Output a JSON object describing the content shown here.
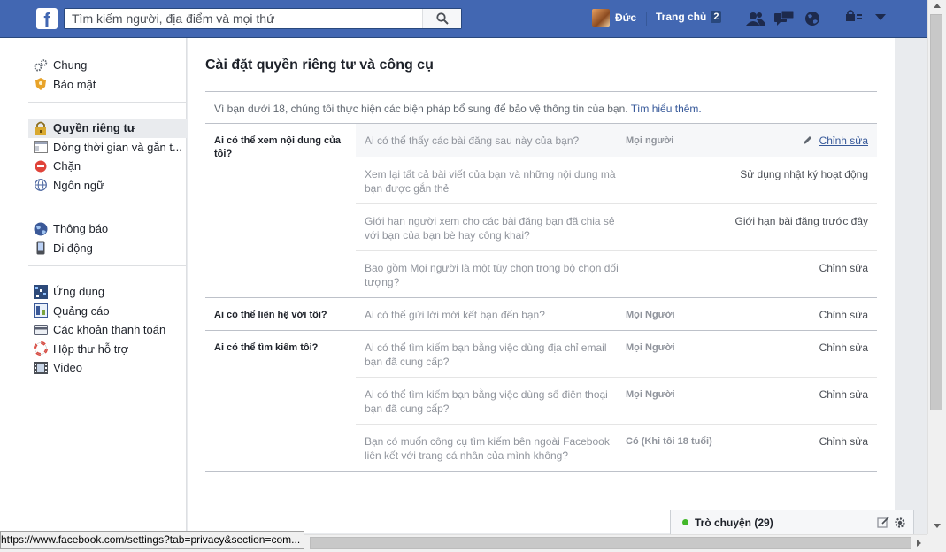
{
  "topbar": {
    "logo": "f",
    "search_placeholder": "Tìm kiếm người, địa điểm và mọi thứ",
    "user_name": "Đức",
    "home_label": "Trang chủ",
    "home_count": "2"
  },
  "sidebar": {
    "groups": [
      {
        "items": [
          {
            "label": "Chung",
            "icon": "gear-icon"
          },
          {
            "label": "Bảo mật",
            "icon": "security-badge-icon"
          }
        ]
      },
      {
        "items": [
          {
            "label": "Quyền riêng tư",
            "icon": "lock-icon",
            "active": true
          },
          {
            "label": "Dòng thời gian và gắn t...",
            "icon": "timeline-icon"
          },
          {
            "label": "Chặn",
            "icon": "block-icon"
          },
          {
            "label": "Ngôn ngữ",
            "icon": "globe-icon"
          }
        ]
      },
      {
        "items": [
          {
            "label": "Thông báo",
            "icon": "notification-globe-icon"
          },
          {
            "label": "Di động",
            "icon": "mobile-icon"
          }
        ]
      },
      {
        "items": [
          {
            "label": "Ứng dụng",
            "icon": "apps-icon"
          },
          {
            "label": "Quảng cáo",
            "icon": "ads-icon"
          },
          {
            "label": "Các khoản thanh toán",
            "icon": "credit-card-icon"
          },
          {
            "label": "Hộp thư hỗ trợ",
            "icon": "lifebuoy-icon"
          },
          {
            "label": "Video",
            "icon": "film-icon"
          }
        ]
      }
    ]
  },
  "main": {
    "title": "Cài đặt quyền riêng tư và công cụ",
    "notice_text": "Vì bạn dưới 18, chúng tôi thực hiện các biện pháp bổ sung để bảo vệ thông tin của bạn. ",
    "notice_link": "Tìm hiểu thêm.",
    "sections": [
      {
        "title": "Ai có thể xem nội dung của tôi?",
        "rows": [
          {
            "question": "Ai có thể thấy các bài đăng sau này của bạn?",
            "value": "Mọi người",
            "action": "Chỉnh sửa",
            "highlight": true
          },
          {
            "question": "Xem lại tất cả bài viết của bạn và những nội dung mà bạn được gắn thẻ",
            "value": "",
            "action": "Sử dụng nhật ký hoạt động"
          },
          {
            "question": "Giới hạn người xem cho các bài đăng bạn đã chia sẻ với bạn của bạn bè hay công khai?",
            "value": "",
            "action": "Giới hạn bài đăng trước đây"
          },
          {
            "question": "Bao gồm Mọi người là một tùy chọn trong bộ chọn đối tượng?",
            "value": "",
            "action": "Chỉnh sửa"
          }
        ]
      },
      {
        "title": "Ai có thể liên hệ với tôi?",
        "rows": [
          {
            "question": "Ai có thể gửi lời mời kết bạn đến bạn?",
            "value": "Mọi Người",
            "action": "Chỉnh sửa"
          }
        ]
      },
      {
        "title": "Ai có thể tìm kiếm tôi?",
        "rows": [
          {
            "question": "Ai có thể tìm kiếm bạn bằng việc dùng địa chỉ email bạn đã cung cấp?",
            "value": "Mọi Người",
            "action": "Chỉnh sửa"
          },
          {
            "question": "Ai có thể tìm kiếm bạn bằng việc dùng số điện thoại bạn đã cung cấp?",
            "value": "Mọi Người",
            "action": "Chỉnh sửa"
          },
          {
            "question": "Bạn có muốn công cụ tìm kiếm bên ngoài Facebook liên kết với trang cá nhân của mình không?",
            "value": "Có (Khi tôi 18 tuổi)",
            "action": "Chỉnh sửa"
          }
        ]
      }
    ]
  },
  "chat": {
    "label": "Trò chuyện (29)"
  },
  "status_url": "https://www.facebook.com/settings?tab=privacy&section=com...",
  "colors": {
    "brand": "#4267b2",
    "link": "#365899",
    "online": "#42b72a"
  }
}
